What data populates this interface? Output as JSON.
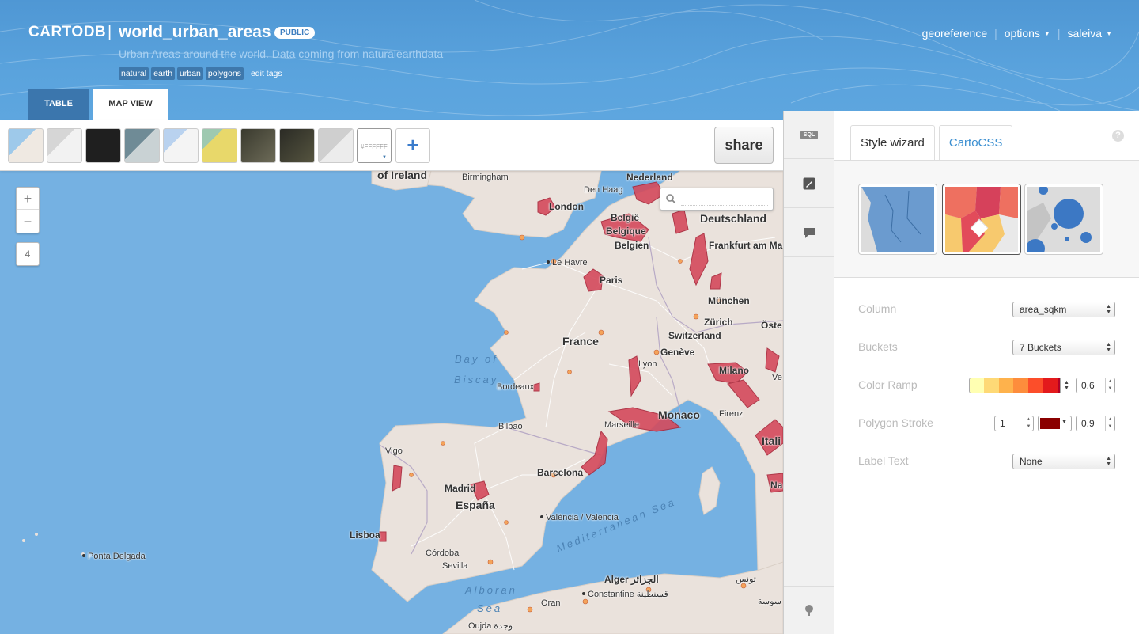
{
  "app": {
    "logo": "CARTODB",
    "table_name": "world_urban_areas",
    "privacy_badge": "PUBLIC",
    "description": "Urban Areas around the world. Data coming from naturalearthdata",
    "tags": [
      "natural",
      "earth",
      "urban",
      "polygons"
    ],
    "edit_tags_label": "edit tags"
  },
  "top_menu": {
    "georeference": "georeference",
    "options": "options",
    "user": "saleiva"
  },
  "view_tabs": {
    "table": "TABLE",
    "map_view": "MAP VIEW"
  },
  "toolbar": {
    "custom_color_value": "#FFFFFF",
    "add_basemap_symbol": "+",
    "share_label": "share",
    "basemaps": [
      "nokia-day",
      "nokia-gray",
      "dark",
      "satellite-gray",
      "nokia-light",
      "nokia-terrain",
      "satellite",
      "satellite-labels",
      "gray-roads"
    ]
  },
  "map": {
    "zoom_in": "+",
    "zoom_out": "−",
    "zoom_level": "4",
    "search_placeholder": "",
    "labels": {
      "ireland": "of Ireland",
      "birmingham": "Birmingham",
      "nederland": "Nederland",
      "den_haag": "Den Haag",
      "london": "London",
      "belgie": "België",
      "belgique": "Belgique",
      "belgien": "Belgien",
      "deutschland": "Deutschland",
      "le_havre": "Le Havre",
      "paris": "Paris",
      "frankfurt": "Frankfurt am Ma",
      "munchen": "München",
      "zurich": "Zürich",
      "oste": "Öste",
      "france": "France",
      "switzerland": "Switzerland",
      "geneve": "Genève",
      "bay_of": "Bay of",
      "biscay": "Biscay",
      "lyon": "Lyon",
      "milano": "Milano",
      "ve": "Ve",
      "bordeaux": "Bordeaux",
      "monaco": "Monaco",
      "firenze": "Firenz",
      "bilbao": "Bilbao",
      "marseille": "Marseille",
      "vigo": "Vigo",
      "italia": "Itali",
      "barcelona": "Barcelona",
      "madrid": "Madrid",
      "espana": "España",
      "na": "Na",
      "valencia": "València / Valencia",
      "lisboa": "Lisboa",
      "ponta_delgada": "Ponta Delgada",
      "cordoba": "Córdoba",
      "sevilla": "Sevilla",
      "mediterranean": "Mediterranean Sea",
      "alger": "Alger الجزائر",
      "tunis": "تونس",
      "constantine": "Constantine قسنطينة",
      "sousse": "سوسة",
      "alboran": "Alboran",
      "sea": "Sea",
      "oran": "Oran",
      "oujda": "Oujda وجدة"
    }
  },
  "panel": {
    "tabs": [
      "Style wizard",
      "CartoCSS"
    ],
    "help": "?",
    "sql_label": "SQL",
    "viz_types": [
      "simple",
      "choropleth",
      "bubble"
    ],
    "rows": {
      "column": {
        "label": "Column",
        "value": "area_sqkm"
      },
      "buckets": {
        "label": "Buckets",
        "value": "7 Buckets"
      },
      "color_ramp": {
        "label": "Color Ramp",
        "opacity": "0.6",
        "colors": [
          "#ffffb2",
          "#fed976",
          "#feb24c",
          "#fd8d3c",
          "#fc4e2a",
          "#e31a1c",
          "#b10026"
        ]
      },
      "polygon_stroke": {
        "label": "Polygon Stroke",
        "width": "1",
        "color": "#8a0000",
        "opacity": "0.9"
      },
      "label_text": {
        "label": "Label Text",
        "value": "None"
      }
    }
  },
  "colors": {
    "header_blue": "#5aa3dd",
    "sea": "#75b1e2",
    "land": "#eae2dc",
    "urban": "#d44a5c",
    "accent": "#3b8fd1"
  }
}
